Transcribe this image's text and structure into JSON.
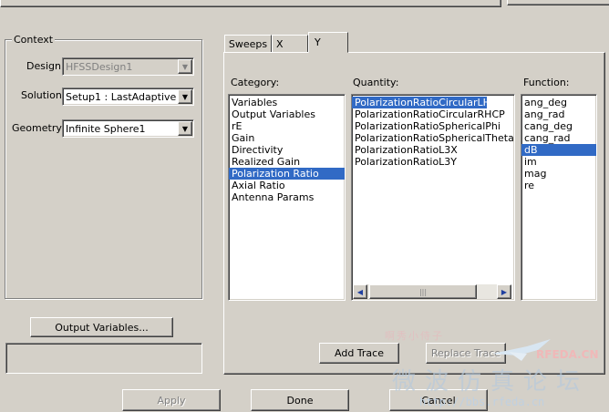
{
  "context": {
    "group_label": "Context",
    "design_label": "Design:",
    "design_value": "HFSSDesign1",
    "solution_label": "Solution:",
    "solution_value": "Setup1 : LastAdaptive",
    "geometry_label": "Geometry:",
    "geometry_value": "Infinite Sphere1"
  },
  "output_variables_button": "Output Variables...",
  "tabs": [
    "Sweeps",
    "X",
    "Y"
  ],
  "category": {
    "header": "Category:",
    "items": [
      "Variables",
      "Output Variables",
      "rE",
      "Gain",
      "Directivity",
      "Realized Gain",
      "Polarization Ratio",
      "Axial Ratio",
      "Antenna Params"
    ],
    "selected": 6
  },
  "quantity": {
    "header": "Quantity:",
    "items": [
      "PolarizationRatioCircularLHCP",
      "PolarizationRatioCircularRHCP",
      "PolarizationRatioSphericalPhi",
      "PolarizationRatioSphericalTheta",
      "PolarizationRatioL3X",
      "PolarizationRatioL3Y"
    ],
    "selected": 0
  },
  "function": {
    "header": "Function:",
    "items": [
      "ang_deg",
      "ang_rad",
      "cang_deg",
      "cang_rad",
      "dB",
      "im",
      "mag",
      "re"
    ],
    "selected": 4
  },
  "buttons": {
    "add_trace": "Add Trace",
    "replace_trace": "Replace Trace",
    "apply": "Apply",
    "done": "Done",
    "cancel": "Cancel"
  },
  "watermark": {
    "brand": "RFEDA.CN",
    "chinese": "微波仿真论坛",
    "url": "http://bbs.rfeda.cn",
    "top": "啊秀小侍子"
  }
}
